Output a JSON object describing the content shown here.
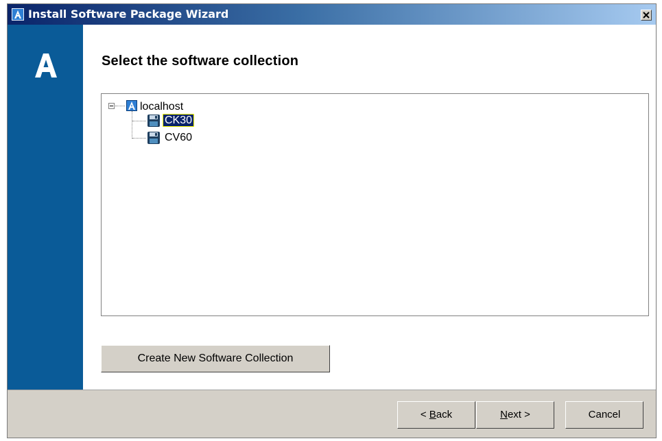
{
  "window": {
    "title": "Install Software Package Wizard",
    "close_symbol": "×",
    "app_icon": "app-logo-a-icon"
  },
  "sidebar": {
    "logo_icon": "app-logo-a-icon",
    "color": "#0a5b98"
  },
  "main": {
    "heading": "Select the software collection",
    "tree": {
      "root": {
        "label": "localhost",
        "icon": "host-icon",
        "expanded": true
      },
      "items": [
        {
          "label": "CK30",
          "icon": "floppy-disk-icon",
          "selected": true
        },
        {
          "label": "CV60",
          "icon": "floppy-disk-icon",
          "selected": false
        }
      ]
    },
    "create_button_label": "Create New Software Collection"
  },
  "footer": {
    "back": {
      "prefix": "< ",
      "mnemonic": "B",
      "rest": "ack"
    },
    "next": {
      "mnemonic": "N",
      "rest": "ext >"
    },
    "cancel_label": "Cancel"
  },
  "colors": {
    "title_gradient_start": "#0a246a",
    "title_gradient_end": "#a6caf0",
    "selection": "#0a246a",
    "dialog_face": "#d4d0c8"
  }
}
